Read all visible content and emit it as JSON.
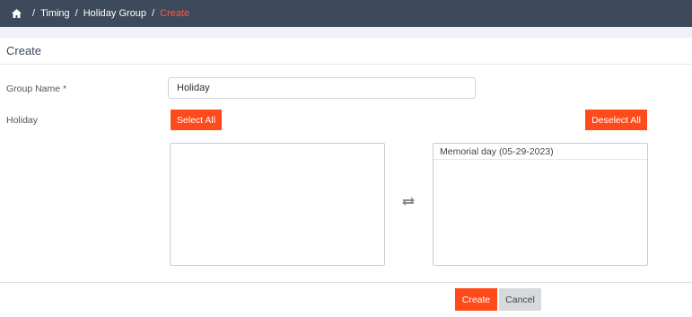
{
  "breadcrumb": {
    "home_icon": "home-icon",
    "items": [
      "Timing",
      "Holiday Group"
    ],
    "current": "Create",
    "separator": "/",
    "current_color": "#ff5a3c"
  },
  "panel": {
    "title": "Create"
  },
  "form": {
    "group_name_label": "Group Name *",
    "group_name_value": "Holiday",
    "holiday_label": "Holiday"
  },
  "dual_list": {
    "select_all_label": "Select All",
    "deselect_all_label": "Deselect All",
    "available_items": [],
    "selected_items": [
      "Memorial day (05-29-2023)"
    ],
    "swap_icon": "swap-arrows-icon"
  },
  "footer": {
    "create_label": "Create",
    "cancel_label": "Cancel"
  },
  "colors": {
    "header_bg": "#3d4a5c",
    "accent": "#ff4a1c",
    "cancel_bg": "#d7dadd"
  }
}
